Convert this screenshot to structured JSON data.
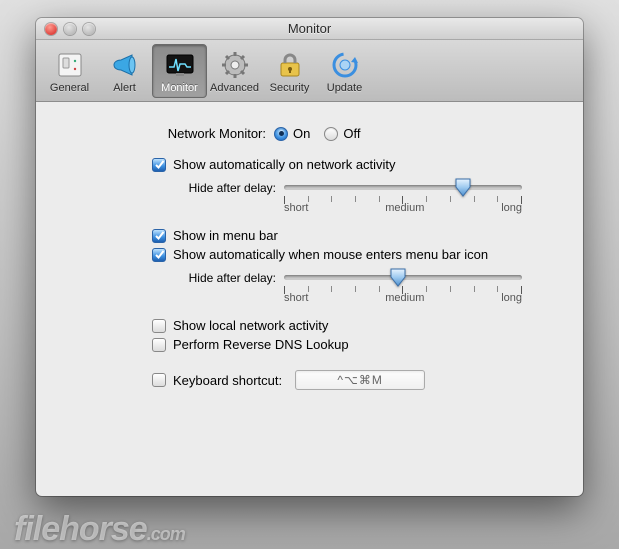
{
  "window": {
    "title": "Monitor"
  },
  "toolbar": {
    "items": [
      {
        "id": "general",
        "label": "General"
      },
      {
        "id": "alert",
        "label": "Alert"
      },
      {
        "id": "monitor",
        "label": "Monitor"
      },
      {
        "id": "advanced",
        "label": "Advanced"
      },
      {
        "id": "security",
        "label": "Security"
      },
      {
        "id": "update",
        "label": "Update"
      }
    ],
    "selected": "monitor"
  },
  "content": {
    "network_monitor_label": "Network Monitor:",
    "on_label": "On",
    "off_label": "Off",
    "network_monitor_value": "on",
    "show_on_activity": {
      "label": "Show automatically on network activity",
      "checked": true
    },
    "hide_delay_label": "Hide after delay:",
    "slider1": {
      "value": 0.75,
      "ticks": {
        "short": "short",
        "medium": "medium",
        "long": "long"
      }
    },
    "show_menu_bar": {
      "label": "Show in menu bar",
      "checked": true
    },
    "show_on_hover": {
      "label": "Show automatically when mouse enters menu bar icon",
      "checked": true
    },
    "slider2": {
      "value": 0.48,
      "ticks": {
        "short": "short",
        "medium": "medium",
        "long": "long"
      }
    },
    "show_local": {
      "label": "Show local network activity",
      "checked": false
    },
    "reverse_dns": {
      "label": "Perform Reverse DNS Lookup",
      "checked": false
    },
    "shortcut": {
      "label": "Keyboard shortcut:",
      "checked": false,
      "value": "^⌥⌘M"
    }
  },
  "watermark": {
    "brand": "filehorse",
    "domain": ".com"
  }
}
